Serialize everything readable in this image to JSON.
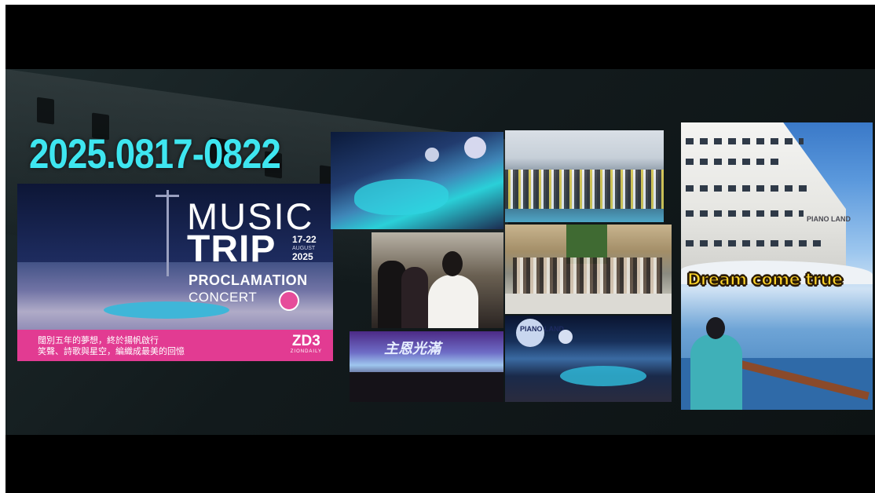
{
  "date_range": "2025.0817-0822",
  "poster": {
    "title_music": "MUSIC",
    "title_trip": "TRIP",
    "dates_days": "17-22",
    "dates_month": "AUGUST",
    "dates_year": "2025",
    "subtitle_proclamation": "PROCLAMATION",
    "subtitle_concert": "CONCERT",
    "tagline_line1": "闊別五年的夢想，終於揚帆啟行",
    "tagline_line2": "笑聲、詩歌與星空，編織成最美的回憶",
    "logo_text": "ZD3",
    "logo_subtext": "ZIONDAILY",
    "accent_color": "#e23b92"
  },
  "photos": {
    "stage_title": "主恩光滿",
    "balloon_label": "PIANO LAND",
    "ship_name": "PIANO LAND"
  },
  "caption_overlay": "Dream come true",
  "colors": {
    "date_text": "#3ee6f0",
    "caption_fill": "#ffd52a"
  }
}
